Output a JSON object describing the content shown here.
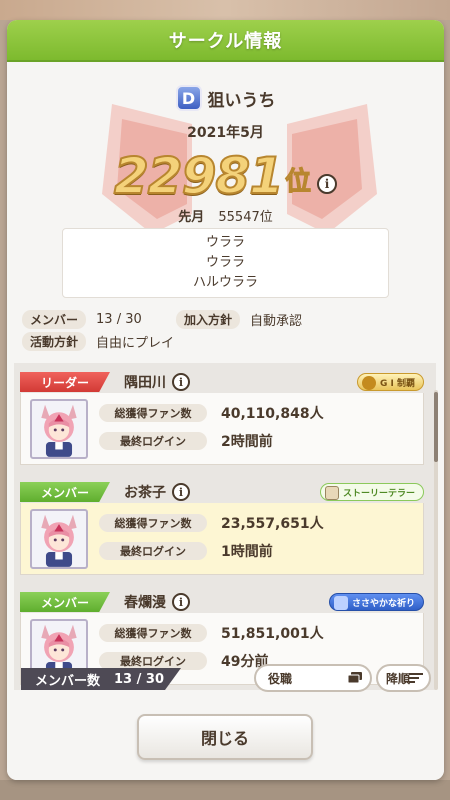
{
  "dialog": {
    "title": "サークル情報"
  },
  "circle": {
    "rank_letter": "D",
    "name": "狙いうち",
    "month": "2021年5月",
    "rank": "22981",
    "rank_suffix": "位",
    "prev_label": "先月",
    "prev_rank": "55547位",
    "motto_lines": [
      "ウララ",
      "ウララ",
      "ハルウララ"
    ],
    "members_label": "メンバー",
    "members_value": "13 / 30",
    "join_label": "加入方針",
    "join_value": "自動承認",
    "activity_label": "活動方針",
    "activity_value": "自由にプレイ"
  },
  "members": [
    {
      "role": "リーダー",
      "name": "隅田川",
      "badge": "G I 制覇",
      "fans_label": "総獲得ファン数",
      "fans": "40,110,848人",
      "login_label": "最終ログイン",
      "login": "2時間前"
    },
    {
      "role": "メンバー",
      "name": "お茶子",
      "badge": "ストーリーテラー",
      "fans_label": "総獲得ファン数",
      "fans": "23,557,651人",
      "login_label": "最終ログイン",
      "login": "1時間前"
    },
    {
      "role": "メンバー",
      "name": "春爛漫",
      "badge": "ささやかな祈り",
      "fans_label": "総獲得ファン数",
      "fans": "51,851,001人",
      "login_label": "最終ログイン",
      "login": "49分前"
    }
  ],
  "footer": {
    "count_label": "メンバー数",
    "count_value": "13 / 30",
    "sort_role_label": "役職",
    "sort_order_label": "降順",
    "close_label": "閉じる"
  },
  "colors": {
    "header_green": "#8cc63f",
    "leader_red": "#e04b45",
    "member_green": "#74c043",
    "rank_gold": "#f4d27a"
  }
}
